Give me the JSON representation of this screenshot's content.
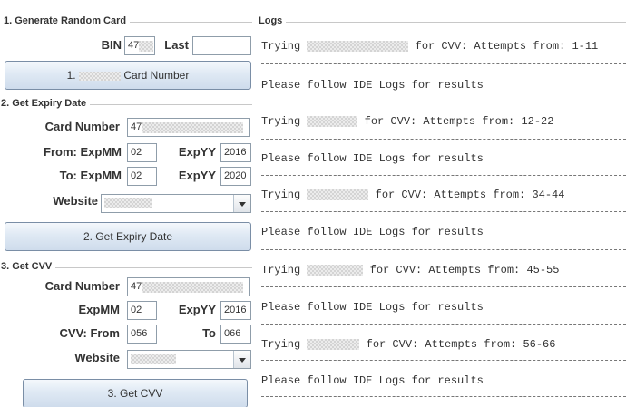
{
  "generate": {
    "title": "1. Generate Random Card",
    "bin_label": "BIN",
    "bin_value": "47",
    "last_label": "Last",
    "last_value": "",
    "button_prefix": "1.",
    "button_suffix": "Card Number"
  },
  "expiry": {
    "title": "2. Get Expiry Date",
    "card_number_label": "Card Number",
    "card_number_value": "47",
    "from_label": "From: ExpMM",
    "from_mm": "02",
    "from_yy_label": "ExpYY",
    "from_yy": "2016",
    "to_label": "To: ExpMM",
    "to_mm": "02",
    "to_yy_label": "ExpYY",
    "to_yy": "2020",
    "website_label": "Website",
    "button_label": "2. Get Expiry Date"
  },
  "cvv": {
    "title": "3. Get CVV",
    "card_number_label": "Card Number",
    "card_number_value": "47",
    "expmm_label": "ExpMM",
    "expmm_value": "02",
    "expyy_label": "ExpYY",
    "expyy_value": "2016",
    "cvv_from_label": "CVV: From",
    "cvv_from_value": "056",
    "cvv_to_label": "To",
    "cvv_to_value": "066",
    "website_label": "Website",
    "button_label": "3. Get CVV"
  },
  "logs": {
    "title": "Logs",
    "entries": [
      {
        "prefix": "Trying ",
        "suffix": " for CVV: Attempts from: 1-11"
      },
      {
        "prefix": "Please follow IDE Logs for results",
        "suffix": ""
      },
      {
        "prefix": "Trying ",
        "suffix": " for CVV: Attempts from: 12-22"
      },
      {
        "prefix": "Please follow IDE Logs for results",
        "suffix": ""
      },
      {
        "prefix": "Trying ",
        "suffix": " for CVV: Attempts from: 34-44"
      },
      {
        "prefix": "Please follow IDE Logs for results",
        "suffix": ""
      },
      {
        "prefix": "Trying ",
        "suffix": " for CVV: Attempts from: 45-55"
      },
      {
        "prefix": "Please follow IDE Logs for results",
        "suffix": ""
      },
      {
        "prefix": "Trying ",
        "suffix": " for CVV: Attempts from: 56-66"
      },
      {
        "prefix": "Please follow IDE Logs for results",
        "suffix": ""
      }
    ]
  }
}
